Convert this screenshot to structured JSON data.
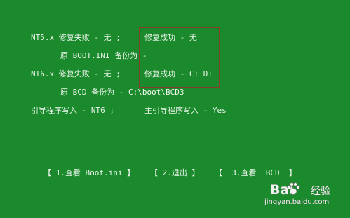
{
  "status": {
    "nt5_label": "NT5.x 修复失败 - 无 ;",
    "nt5_result": "修复成功 - 无",
    "nt5_backup": "原 BOOT.INI 备份为 -",
    "nt6_label": "NT6.x 修复失败 - 无 ;",
    "nt6_result": "修复成功 - C: D:",
    "nt6_backup": "原 BCD 备份为 - C:\\boot\\BCD3",
    "boot_write": "引导程序写入 - NT6 ;",
    "mbr_write": "主引导程序写入 - Yes"
  },
  "divider": "- - - - - - - - - - - - - - - - - - - - - - - - - - - - - - - - - - - - - - - - - - - - - - - - - - - - - - - - - - - - - - - - - - - - - - - - - - - - - - - - - - - -",
  "menu": {
    "view_boot_ini": "【 1.查看 Boot.ini 】",
    "exit": "【 2.退出 】",
    "view_bcd": "【  3.查看  BCD  】"
  },
  "watermark": {
    "logo": "Bai  ",
    "brand_text": "经验",
    "url": "jingyan.baidu.com"
  },
  "colors": {
    "background": "#1a8a2c",
    "text": "#eef6ee",
    "highlight_border": "#8a3b2b"
  }
}
